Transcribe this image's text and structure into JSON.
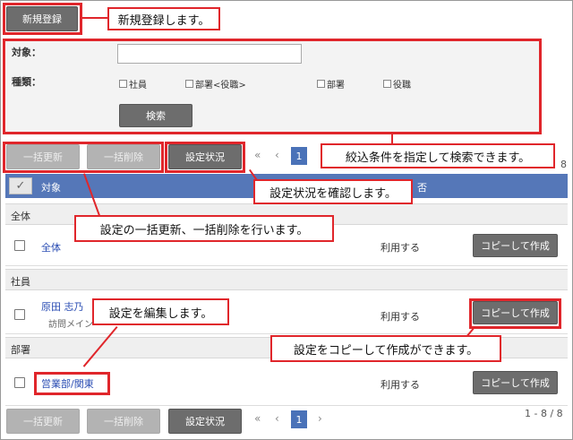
{
  "top": {
    "new_button": "新規登録"
  },
  "search": {
    "target_label": "対象：",
    "type_label": "種類：",
    "target_value": "",
    "options": [
      "社員",
      "部署<役職>",
      "部署",
      "役職"
    ],
    "search_button": "検索"
  },
  "toolbar": {
    "bulk_update": "一括更新",
    "bulk_delete": "一括削除",
    "settings_status": "設定状況",
    "first_glyph": "«",
    "prev_glyph": "‹",
    "next_glyph": "›",
    "current_page": "1",
    "count_tail": "8"
  },
  "table": {
    "header_target": "対象",
    "header_usage_tail": "否",
    "groups": [
      {
        "name": "全体",
        "rows": [
          {
            "target": "全体",
            "sub": "",
            "usage": "利用する",
            "copy": "コピーして作成"
          }
        ]
      },
      {
        "name": "社員",
        "rows": [
          {
            "target": "原田 志乃",
            "sub": "訪問メイン",
            "usage": "利用する",
            "copy": "コピーして作成"
          }
        ]
      },
      {
        "name": "部署",
        "rows": [
          {
            "target": "営業部/関東",
            "sub": "",
            "usage": "利用する",
            "copy": "コピーして作成"
          }
        ]
      }
    ]
  },
  "bottom": {
    "bulk_update": "一括更新",
    "bulk_delete": "一括削除",
    "settings_status": "設定状況",
    "first_glyph": "«",
    "prev_glyph": "‹",
    "next_glyph": "›",
    "current_page": "1",
    "range": "1 - 8 / 8"
  },
  "callouts": {
    "new": "新規登録します。",
    "filter": "絞込条件を指定して検索できます。",
    "status": "設定状況を確認します。",
    "bulk": "設定の一括更新、一括削除を行います。",
    "edit": "設定を編集します。",
    "copy": "設定をコピーして作成ができます。"
  },
  "colors": {
    "accent_red": "#e0262b",
    "header_blue": "#5577b8",
    "button_dark": "#6d6d6d",
    "link_blue": "#2a4db3"
  }
}
